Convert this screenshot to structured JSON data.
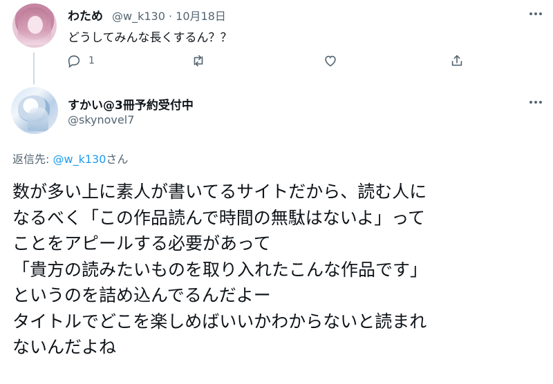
{
  "parent_tweet": {
    "display_name": "わため",
    "handle": "@w_k130",
    "separator": "·",
    "date": "10月18日",
    "text": "どうしてみんな長くするん？？",
    "reply_count": "1",
    "avatar_icon": "avatar-image"
  },
  "reply_tweet": {
    "display_name": "すかい@3冊予約受付中",
    "handle": "@skynovel7",
    "reply_to_label": "返信先: ",
    "reply_to_mention": "@w_k130",
    "reply_to_suffix": "さん",
    "lines": [
      "数が多い上に素人が書いてるサイトだから、読む人に",
      "なるべく「この作品読んで時間の無駄はないよ」って",
      "ことをアピールする必要があって",
      "「貴方の読みたいものを取り入れたこんな作品です」",
      "というのを詰め込んでるんだよー",
      "タイトルでどこを楽しめばいいかわからないと読まれ",
      "ないんだよね"
    ]
  },
  "colors": {
    "text_primary": "#0f1419",
    "text_secondary": "#536471",
    "link": "#1d9bf0",
    "thread_line": "#cfd9de"
  }
}
